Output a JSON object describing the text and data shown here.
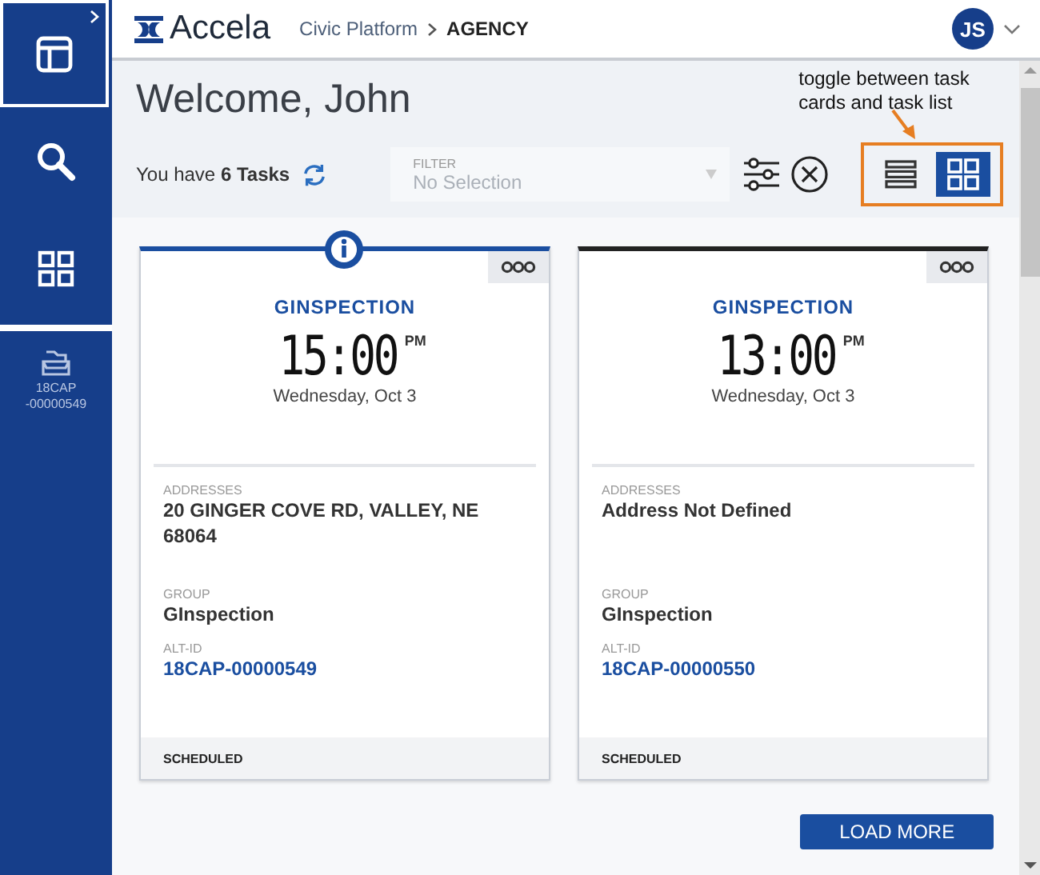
{
  "sidebar": {
    "items": [
      {
        "kind": "dashboard",
        "selected": true
      },
      {
        "kind": "search",
        "selected": false
      },
      {
        "kind": "apps",
        "selected": false
      }
    ],
    "record": "18CAP -00000549"
  },
  "header": {
    "logo": "Accela",
    "breadcrumb": [
      "Civic Platform",
      "AGENCY"
    ],
    "avatar": "JS"
  },
  "welcome": "Welcome, John",
  "tasks_summary": "You have **6 Tasks**",
  "filter": {
    "label": "FILTER",
    "placeholder": "No Selection"
  },
  "view_toggle": [
    {
      "kind": "list",
      "selected": false
    },
    {
      "kind": "cards",
      "selected": true
    }
  ],
  "annotation": "toggle between task cards and task list",
  "cards": [
    {
      "alert": true,
      "type": "GINSPECTION",
      "time": "15:00",
      "meridiem": "PM",
      "date": "Wednesday, Oct 3",
      "fields": [
        {
          "label": "ADDRESSES",
          "value": "20 GINGER COVE RD, VALLEY, NE 68064",
          "kind": "text"
        },
        {
          "label": "GROUP",
          "value": "GInspection",
          "kind": "text"
        },
        {
          "label": "ALT-ID",
          "value": "18CAP-00000549",
          "kind": "link"
        }
      ],
      "status": "SCHEDULED"
    },
    {
      "alert": false,
      "type": "GINSPECTION",
      "time": "13:00",
      "meridiem": "PM",
      "date": "Wednesday, Oct 3",
      "fields": [
        {
          "label": "ADDRESSES",
          "value": "Address Not Defined",
          "kind": "text"
        },
        {
          "label": "GROUP",
          "value": "GInspection",
          "kind": "text"
        },
        {
          "label": "ALT-ID",
          "value": "18CAP-00000550",
          "kind": "link"
        }
      ],
      "status": "SCHEDULED"
    }
  ],
  "load_more": "LOAD MORE"
}
